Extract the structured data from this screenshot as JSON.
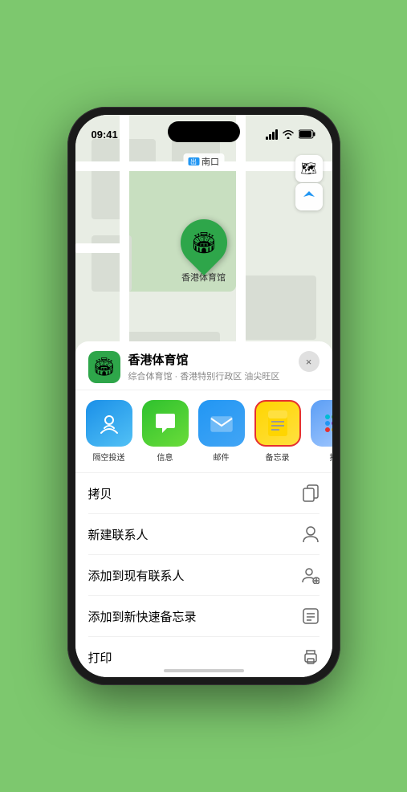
{
  "status_bar": {
    "time": "09:41",
    "location_arrow": "▶"
  },
  "map": {
    "location_label": "南口",
    "pin_label": "香港体育馆",
    "controls": {
      "map_type_icon": "🗺",
      "location_icon": "➤"
    }
  },
  "bottom_sheet": {
    "venue_name": "香港体育馆",
    "venue_subtitle": "综合体育馆 · 香港特别行政区 油尖旺区",
    "close_label": "×",
    "share_items": [
      {
        "id": "airdrop",
        "label": "隔空投送",
        "emoji": "📡"
      },
      {
        "id": "messages",
        "label": "信息",
        "emoji": "💬"
      },
      {
        "id": "mail",
        "label": "邮件",
        "emoji": "✉"
      },
      {
        "id": "notes",
        "label": "备忘录",
        "emoji": "📝"
      },
      {
        "id": "more",
        "label": "推",
        "emoji": "···"
      }
    ],
    "action_items": [
      {
        "label": "拷贝",
        "icon": "📋"
      },
      {
        "label": "新建联系人",
        "icon": "👤"
      },
      {
        "label": "添加到现有联系人",
        "icon": "👤"
      },
      {
        "label": "添加到新快速备忘录",
        "icon": "📋"
      },
      {
        "label": "打印",
        "icon": "🖨"
      }
    ]
  }
}
